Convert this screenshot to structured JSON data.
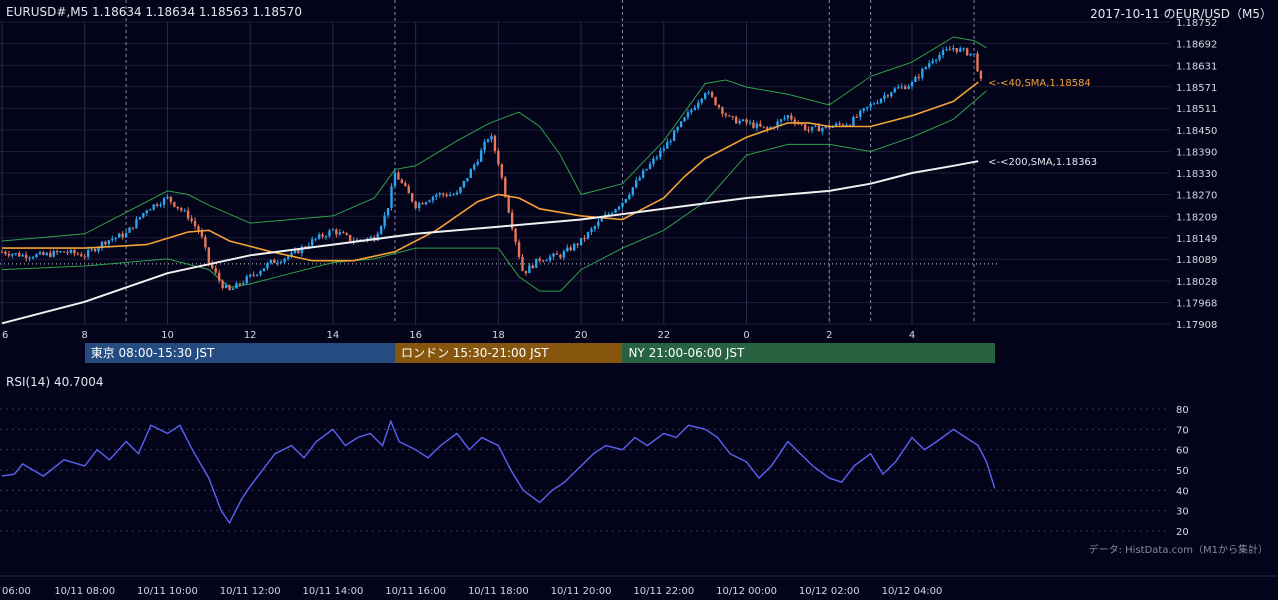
{
  "header": {
    "symbol_info": "EURUSD#,M5 1.18634 1.18634 1.18563 1.18570",
    "date_title": "2017-10-11 のEUR/USD（M5）"
  },
  "colors": {
    "background": "#03031a",
    "up_candle": "#2aa6ee",
    "down_candle": "#e9765a",
    "sma40": "#f5a236",
    "sma200": "#f0f0f0",
    "bollinger": "#2fa24a",
    "rsi": "#5a63f2",
    "tokyo": "#244c80",
    "london": "#87560e",
    "ny": "#276340"
  },
  "sessions": [
    {
      "label": "東京 08:00-15:30 JST",
      "start": 8.0,
      "end": 15.5,
      "color": "#244c80"
    },
    {
      "label": "ロンドン 15:30-21:00 JST",
      "start": 15.5,
      "end": 21.0,
      "color": "#87560e"
    },
    {
      "label": "NY 21:00-06:00 JST",
      "start": 21.0,
      "end": 30.0,
      "color": "#276340"
    }
  ],
  "footer": {
    "credit": "データ: HistData.com（M1から集計）"
  },
  "chart_data": [
    {
      "type": "candlestick",
      "x_unit": "hours since 2017-10-11 00:00 JST",
      "x_range": [
        6,
        30.2
      ],
      "ylim": [
        1.17908,
        1.18752
      ],
      "x_ticks": [
        {
          "x": 6,
          "label": "6"
        },
        {
          "x": 8,
          "label": "8"
        },
        {
          "x": 10,
          "label": "10"
        },
        {
          "x": 12,
          "label": "12"
        },
        {
          "x": 14,
          "label": "14"
        },
        {
          "x": 16,
          "label": "16"
        },
        {
          "x": 18,
          "label": "18"
        },
        {
          "x": 20,
          "label": "20"
        },
        {
          "x": 22,
          "label": "22"
        },
        {
          "x": 24,
          "label": "0"
        },
        {
          "x": 26,
          "label": "2"
        },
        {
          "x": 28,
          "label": "4"
        }
      ],
      "y_ticks": [
        "1.18752",
        "1.18692",
        "1.18631",
        "1.18571",
        "1.18511",
        "1.18450",
        "1.18390",
        "1.18330",
        "1.18270",
        "1.18209",
        "1.18149",
        "1.18089",
        "1.18028",
        "1.17968",
        "1.17908"
      ],
      "reference_price": 1.18076,
      "session_markers": [
        9.0,
        15.5,
        21.0,
        26.0,
        27.0,
        29.5
      ],
      "series": [
        {
          "name": "40,SMA",
          "label": "<-<40,SMA,1.18584",
          "last": 1.18584,
          "color": "#f5a236",
          "points": [
            [
              6,
              1.1812
            ],
            [
              8,
              1.1812
            ],
            [
              9.5,
              1.1813
            ],
            [
              10.5,
              1.18165
            ],
            [
              11,
              1.1817
            ],
            [
              11.5,
              1.1814
            ],
            [
              12.5,
              1.1811
            ],
            [
              13.5,
              1.18085
            ],
            [
              14.5,
              1.18085
            ],
            [
              15.5,
              1.1811
            ],
            [
              16.5,
              1.1817
            ],
            [
              17.5,
              1.1825
            ],
            [
              18,
              1.1827
            ],
            [
              18.5,
              1.1826
            ],
            [
              19,
              1.1823
            ],
            [
              20,
              1.1821
            ],
            [
              21,
              1.182
            ],
            [
              22,
              1.1826
            ],
            [
              22.5,
              1.1832
            ],
            [
              23,
              1.1837
            ],
            [
              23.5,
              1.184
            ],
            [
              24,
              1.1843
            ],
            [
              25,
              1.1847
            ],
            [
              25.5,
              1.1847
            ],
            [
              26,
              1.1846
            ],
            [
              27,
              1.1846
            ],
            [
              28,
              1.1849
            ],
            [
              29,
              1.1853
            ],
            [
              29.6,
              1.18584
            ]
          ]
        },
        {
          "name": "200,SMA",
          "label": "<-<200,SMA,1.18363",
          "last": 1.18363,
          "color": "#f0f0f0",
          "points": [
            [
              6,
              1.1791
            ],
            [
              8,
              1.1797
            ],
            [
              10,
              1.1805
            ],
            [
              12,
              1.181
            ],
            [
              14,
              1.1813
            ],
            [
              16,
              1.1816
            ],
            [
              18,
              1.1818
            ],
            [
              20,
              1.182
            ],
            [
              22,
              1.1823
            ],
            [
              24,
              1.1826
            ],
            [
              26,
              1.1828
            ],
            [
              27,
              1.183
            ],
            [
              28,
              1.1833
            ],
            [
              29,
              1.1835
            ],
            [
              29.6,
              1.18363
            ]
          ]
        },
        {
          "name": "Bollinger upper",
          "color": "#2fa24a",
          "points": [
            [
              6,
              1.1814
            ],
            [
              8,
              1.1816
            ],
            [
              9,
              1.1822
            ],
            [
              10,
              1.1828
            ],
            [
              10.5,
              1.1827
            ],
            [
              11,
              1.1824
            ],
            [
              12,
              1.1819
            ],
            [
              13,
              1.182
            ],
            [
              14,
              1.1821
            ],
            [
              15,
              1.1826
            ],
            [
              15.5,
              1.1834
            ],
            [
              16,
              1.1835
            ],
            [
              17,
              1.1842
            ],
            [
              17.8,
              1.1847
            ],
            [
              18.5,
              1.185
            ],
            [
              19,
              1.1846
            ],
            [
              19.5,
              1.1838
            ],
            [
              20,
              1.1827
            ],
            [
              21,
              1.183
            ],
            [
              22,
              1.1842
            ],
            [
              23,
              1.1858
            ],
            [
              23.5,
              1.1859
            ],
            [
              24,
              1.1857
            ],
            [
              25,
              1.1855
            ],
            [
              26,
              1.1852
            ],
            [
              27,
              1.186
            ],
            [
              28,
              1.1864
            ],
            [
              29,
              1.1871
            ],
            [
              29.5,
              1.187
            ],
            [
              29.8,
              1.1868
            ]
          ]
        },
        {
          "name": "Bollinger lower",
          "color": "#2fa24a",
          "points": [
            [
              6,
              1.1806
            ],
            [
              8,
              1.1807
            ],
            [
              9,
              1.1808
            ],
            [
              10,
              1.1809
            ],
            [
              11,
              1.1806
            ],
            [
              11.5,
              1.1801
            ],
            [
              12,
              1.1802
            ],
            [
              13,
              1.1805
            ],
            [
              14,
              1.1808
            ],
            [
              15,
              1.1809
            ],
            [
              16,
              1.1812
            ],
            [
              17,
              1.1812
            ],
            [
              18,
              1.1812
            ],
            [
              18.5,
              1.1804
            ],
            [
              19,
              1.18
            ],
            [
              19.5,
              1.18
            ],
            [
              20,
              1.1806
            ],
            [
              21,
              1.1812
            ],
            [
              22,
              1.1817
            ],
            [
              23,
              1.1825
            ],
            [
              24,
              1.1838
            ],
            [
              25,
              1.1841
            ],
            [
              26,
              1.1841
            ],
            [
              27,
              1.1839
            ],
            [
              28,
              1.1843
            ],
            [
              29,
              1.1848
            ],
            [
              29.8,
              1.1856
            ]
          ]
        }
      ],
      "candles_close_path": [
        [
          6,
          1.1811
        ],
        [
          6.5,
          1.181
        ],
        [
          7,
          1.181
        ],
        [
          7.5,
          1.1811
        ],
        [
          8,
          1.181
        ],
        [
          8.5,
          1.1814
        ],
        [
          9,
          1.1816
        ],
        [
          9.5,
          1.1823
        ],
        [
          10,
          1.1826
        ],
        [
          10.5,
          1.1821
        ],
        [
          10.8,
          1.1816
        ],
        [
          11,
          1.1808
        ],
        [
          11.3,
          1.1802
        ],
        [
          11.5,
          1.18
        ],
        [
          12,
          1.1804
        ],
        [
          12.5,
          1.1808
        ],
        [
          13,
          1.181
        ],
        [
          13.5,
          1.1814
        ],
        [
          14,
          1.1817
        ],
        [
          14.5,
          1.1814
        ],
        [
          15,
          1.1815
        ],
        [
          15.3,
          1.1822
        ],
        [
          15.5,
          1.1833
        ],
        [
          16,
          1.1824
        ],
        [
          16.5,
          1.1827
        ],
        [
          17,
          1.1827
        ],
        [
          17.5,
          1.1837
        ],
        [
          17.8,
          1.1844
        ],
        [
          18,
          1.1836
        ],
        [
          18.3,
          1.182
        ],
        [
          18.6,
          1.1805
        ],
        [
          19,
          1.1809
        ],
        [
          19.5,
          1.181
        ],
        [
          20,
          1.1814
        ],
        [
          20.5,
          1.182
        ],
        [
          21,
          1.1825
        ],
        [
          21.5,
          1.1833
        ],
        [
          22,
          1.184
        ],
        [
          22.5,
          1.1848
        ],
        [
          23,
          1.1856
        ],
        [
          23.3,
          1.1852
        ],
        [
          23.6,
          1.1848
        ],
        [
          24,
          1.1847
        ],
        [
          24.5,
          1.1845
        ],
        [
          25,
          1.1849
        ],
        [
          25.5,
          1.1845
        ],
        [
          26,
          1.1846
        ],
        [
          26.5,
          1.1847
        ],
        [
          27,
          1.1852
        ],
        [
          27.5,
          1.1856
        ],
        [
          28,
          1.1858
        ],
        [
          28.5,
          1.1865
        ],
        [
          29,
          1.1868
        ],
        [
          29.5,
          1.1866
        ],
        [
          29.7,
          1.1857
        ]
      ]
    },
    {
      "type": "line",
      "title": "RSI(14) 40.7004",
      "x_unit": "hours since 2017-10-11 00:00 JST",
      "x_range": [
        6,
        30.2
      ],
      "ylim": [
        20,
        80
      ],
      "y_ticks": [
        "80",
        "70",
        "60",
        "50",
        "40",
        "30",
        "20"
      ],
      "x_ticks": [
        {
          "x": 6,
          "label": "06:00"
        },
        {
          "x": 8,
          "label": "10/11 08:00"
        },
        {
          "x": 10,
          "label": "10/11 10:00"
        },
        {
          "x": 12,
          "label": "10/11 12:00"
        },
        {
          "x": 14,
          "label": "10/11 14:00"
        },
        {
          "x": 16,
          "label": "10/11 16:00"
        },
        {
          "x": 18,
          "label": "10/11 18:00"
        },
        {
          "x": 20,
          "label": "10/11 20:00"
        },
        {
          "x": 22,
          "label": "10/11 22:00"
        },
        {
          "x": 24,
          "label": "10/12 00:00"
        },
        {
          "x": 26,
          "label": "10/12 02:00"
        },
        {
          "x": 28,
          "label": "10/12 04:00"
        }
      ],
      "series": [
        {
          "name": "RSI(14)",
          "color": "#5a63f2",
          "points": [
            [
              6,
              47
            ],
            [
              6.3,
              48
            ],
            [
              6.5,
              53
            ],
            [
              7,
              47
            ],
            [
              7.5,
              55
            ],
            [
              8,
              52
            ],
            [
              8.3,
              60
            ],
            [
              8.6,
              55
            ],
            [
              9,
              64
            ],
            [
              9.3,
              58
            ],
            [
              9.6,
              72
            ],
            [
              10,
              68
            ],
            [
              10.3,
              72
            ],
            [
              10.6,
              60
            ],
            [
              11,
              46
            ],
            [
              11.3,
              30
            ],
            [
              11.5,
              24
            ],
            [
              11.8,
              36
            ],
            [
              12,
              42
            ],
            [
              12.3,
              50
            ],
            [
              12.6,
              58
            ],
            [
              13,
              62
            ],
            [
              13.3,
              56
            ],
            [
              13.6,
              64
            ],
            [
              14,
              70
            ],
            [
              14.3,
              62
            ],
            [
              14.6,
              66
            ],
            [
              14.9,
              68
            ],
            [
              15.2,
              62
            ],
            [
              15.4,
              74
            ],
            [
              15.6,
              64
            ],
            [
              16,
              60
            ],
            [
              16.3,
              56
            ],
            [
              16.6,
              62
            ],
            [
              17,
              68
            ],
            [
              17.3,
              60
            ],
            [
              17.6,
              66
            ],
            [
              18,
              62
            ],
            [
              18.3,
              50
            ],
            [
              18.6,
              40
            ],
            [
              19,
              34
            ],
            [
              19.3,
              40
            ],
            [
              19.6,
              44
            ],
            [
              20,
              52
            ],
            [
              20.3,
              58
            ],
            [
              20.6,
              62
            ],
            [
              21,
              60
            ],
            [
              21.3,
              66
            ],
            [
              21.6,
              62
            ],
            [
              22,
              68
            ],
            [
              22.3,
              66
            ],
            [
              22.6,
              72
            ],
            [
              23,
              70
            ],
            [
              23.3,
              66
            ],
            [
              23.6,
              58
            ],
            [
              24,
              54
            ],
            [
              24.3,
              46
            ],
            [
              24.6,
              52
            ],
            [
              25,
              64
            ],
            [
              25.3,
              58
            ],
            [
              25.6,
              52
            ],
            [
              26,
              46
            ],
            [
              26.3,
              44
            ],
            [
              26.6,
              52
            ],
            [
              27,
              58
            ],
            [
              27.3,
              48
            ],
            [
              27.6,
              54
            ],
            [
              28,
              66
            ],
            [
              28.3,
              60
            ],
            [
              28.6,
              64
            ],
            [
              29,
              70
            ],
            [
              29.3,
              66
            ],
            [
              29.6,
              62
            ],
            [
              29.8,
              54
            ],
            [
              30,
              41
            ]
          ]
        }
      ]
    }
  ]
}
